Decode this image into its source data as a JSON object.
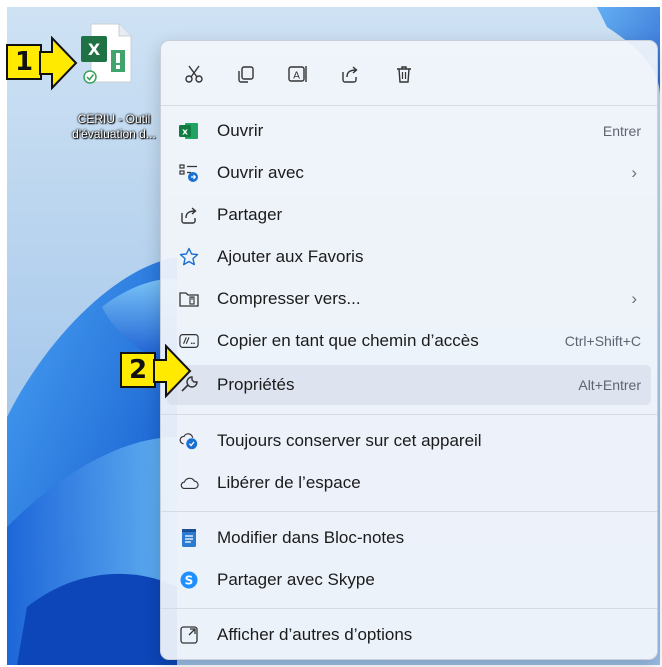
{
  "desktop": {
    "file_icon": "excel-file-icon",
    "file_caption_line1": "CERIU - Outil",
    "file_caption_line2": "d'évaluation d..."
  },
  "markers": [
    "1",
    "2"
  ],
  "menu": {
    "toolbar": [
      {
        "name": "cut-icon",
        "tooltip": "Couper"
      },
      {
        "name": "copy-icon",
        "tooltip": "Copier"
      },
      {
        "name": "rename-icon",
        "tooltip": "Renommer"
      },
      {
        "name": "share-icon",
        "tooltip": "Partager"
      },
      {
        "name": "delete-icon",
        "tooltip": "Supprimer"
      }
    ],
    "items": [
      {
        "label": "Ouvrir",
        "shortcut": "Entrer",
        "icon": "excel-icon"
      },
      {
        "label": "Ouvrir avec",
        "shortcut": "›",
        "icon": "open-with-icon"
      },
      {
        "label": "Partager",
        "shortcut": "",
        "icon": "share-icon"
      },
      {
        "label": "Ajouter aux Favoris",
        "shortcut": "",
        "icon": "star-icon"
      },
      {
        "label": "Compresser vers...",
        "shortcut": "›",
        "icon": "zip-folder-icon"
      },
      {
        "label": "Copier en tant que chemin d’accès",
        "shortcut": "Ctrl+Shift+C",
        "icon": "copy-path-icon"
      },
      {
        "label": "Propriétés",
        "shortcut": "Alt+Entrer",
        "icon": "properties-wrench-icon"
      },
      {
        "label": "Toujours conserver sur cet appareil",
        "shortcut": "",
        "icon": "cloud-sync-icon"
      },
      {
        "label": "Libérer de l’espace",
        "shortcut": "",
        "icon": "cloud-icon"
      },
      {
        "label": "Modifier dans Bloc-notes",
        "shortcut": "",
        "icon": "notepad-icon"
      },
      {
        "label": "Partager avec Skype",
        "shortcut": "",
        "icon": "skype-icon"
      },
      {
        "label": "Afficher d’autres d’options",
        "shortcut": "",
        "icon": "more-options-icon"
      }
    ]
  },
  "colors": {
    "marker_yellow": "#ffea00",
    "excel_green": "#1f7244",
    "accent_blue": "#1a6fd1",
    "skype_blue": "#1e90ff"
  }
}
